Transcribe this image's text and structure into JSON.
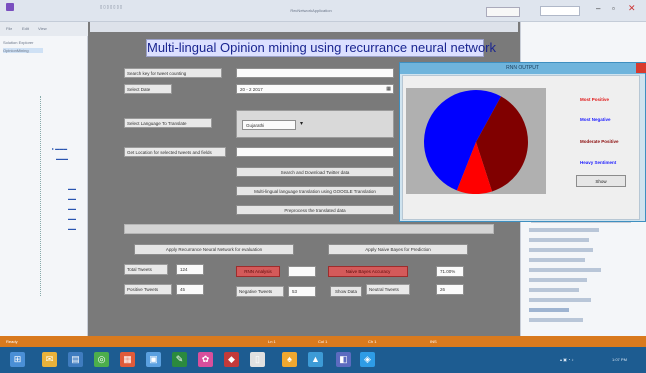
{
  "ide": {
    "window_title": "RecNetworkApplication",
    "menu": [
      "File",
      "Edit",
      "View"
    ],
    "solution_label": "Solution Explorer",
    "tree_items": [
      "OpinionMining",
      "",
      "",
      "",
      ""
    ]
  },
  "app": {
    "headline": "Multi-lingual Opinion mining using recurrance neural network",
    "fields": {
      "keyword_label": "Search key for tweet counting",
      "keyword_value": "",
      "date_label": "Select Date",
      "date_value": "20 - 2 2017",
      "language_label": "Select Language To Translate",
      "language_value": "Gujarathi",
      "location_label": "Get Location for selected tweets and fields",
      "location_value": ""
    },
    "buttons": {
      "search_download": "Search and Download Twitter data",
      "multilang_translate": "Multi-lingual language translation using GOOGLE Translation",
      "preprocess": "Preprocess the translated data",
      "apply_rnn": "Apply Recurrance Neural Network for evaluation",
      "apply_naive_bayes": "Apply Naive Bayes for Prediction",
      "rnn_results": "RNN Analysis",
      "nb_results": "Naive Bayes Accuracy",
      "show_data": "Show Data"
    },
    "stats": {
      "total_tweets_label": "Total Tweets",
      "total_tweets_value": "124",
      "positive_tweets_label": "Positive Tweets",
      "positive_tweets_value": "45",
      "negative_tweets_label": "Negative Tweets",
      "negative_tweets_value": "53",
      "neutral_tweets_label": "Neutral Tweets",
      "neutral_tweets_value": "26",
      "rnn_accuracy_value": "",
      "nb_accuracy_value": "71.00%"
    }
  },
  "dialog": {
    "title": "RNN OUTPUT",
    "legend": [
      {
        "label": "Most Positive",
        "color": "#e01818"
      },
      {
        "label": "Most Negative",
        "color": "#1a1aff"
      },
      {
        "label": "Moderate Positive",
        "color": "#8a0a0a"
      },
      {
        "label": "Heavy Sentiment",
        "color": "#1a1aff"
      }
    ],
    "button": "Show"
  },
  "chart_data": {
    "type": "pie",
    "title": "",
    "slices": [
      {
        "name": "Most Negative",
        "value": 52,
        "color": "#0000ff"
      },
      {
        "name": "Moderate Positive",
        "value": 37,
        "color": "#800000"
      },
      {
        "name": "Most Positive",
        "value": 11,
        "color": "#ff0000"
      }
    ]
  },
  "statusbar": {
    "left": "Ready",
    "items": [
      "Ln 1",
      "Col 1",
      "Ch 1",
      "INS"
    ]
  },
  "taskbar": {
    "icon_colors": [
      "#4a8fd6",
      "#e9b23b",
      "#3f7cbf",
      "#4cae4c",
      "#e05b3a",
      "#5aa0e0",
      "#2b8a3e",
      "#d94f9c",
      "#c43a3a",
      "#e0e0e0",
      "#f0a830",
      "#3d9bd6",
      "#5c6bc0",
      "#2e9ce6"
    ],
    "clock": "1:07 PM"
  }
}
